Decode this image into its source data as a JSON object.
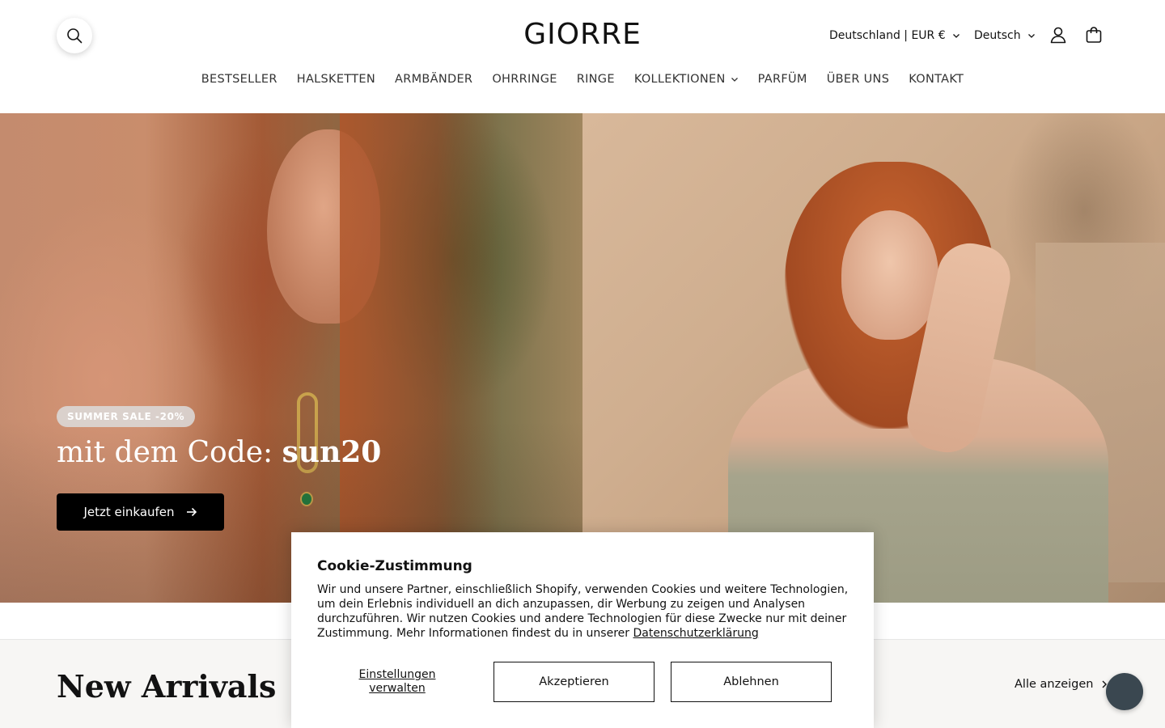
{
  "brand": {
    "logo_text": "GIORRE"
  },
  "header": {
    "country_selector": "Deutschland | EUR €",
    "language_selector": "Deutsch",
    "icons": {
      "search": "search-icon",
      "account": "user-icon",
      "cart": "bag-icon"
    }
  },
  "nav": {
    "items": [
      {
        "label": "BESTSELLER"
      },
      {
        "label": "HALSKETTEN"
      },
      {
        "label": "ARMBÄNDER"
      },
      {
        "label": "OHRRINGE"
      },
      {
        "label": "RINGE"
      },
      {
        "label": "KOLLEKTIONEN",
        "has_dropdown": true
      },
      {
        "label": "PARFÜM"
      },
      {
        "label": "ÜBER UNS"
      },
      {
        "label": "KONTAKT"
      }
    ]
  },
  "hero": {
    "badge": "SUMMER SALE -20%",
    "headline_prefix": "mit dem Code: ",
    "headline_code": "sun20",
    "cta_label": "Jetzt einkaufen"
  },
  "section": {
    "title": "New Arrivals",
    "view_all_label": "Alle anzeigen"
  },
  "cookie": {
    "title": "Cookie-Zustimmung",
    "body": "Wir und unsere Partner, einschließlich Shopify, verwenden Cookies und weitere Technologien, um dein Erlebnis individuell an dich anzupassen, dir Werbung zu zeigen und Analysen durchzuführen. Wir nutzen Cookies und andere Technologien für diese Zwecke nur mit deiner Zustimmung. Mehr Informationen findest du in unserer ",
    "privacy_link": "Datenschutzerklärung",
    "manage_label": "Einstellungen verwalten",
    "accept_label": "Akzeptieren",
    "decline_label": "Ablehnen"
  },
  "colors": {
    "text": "#121212",
    "cta_background": "#000000",
    "chat_bubble": "#3a4750",
    "section_background": "#f7f6f4"
  }
}
